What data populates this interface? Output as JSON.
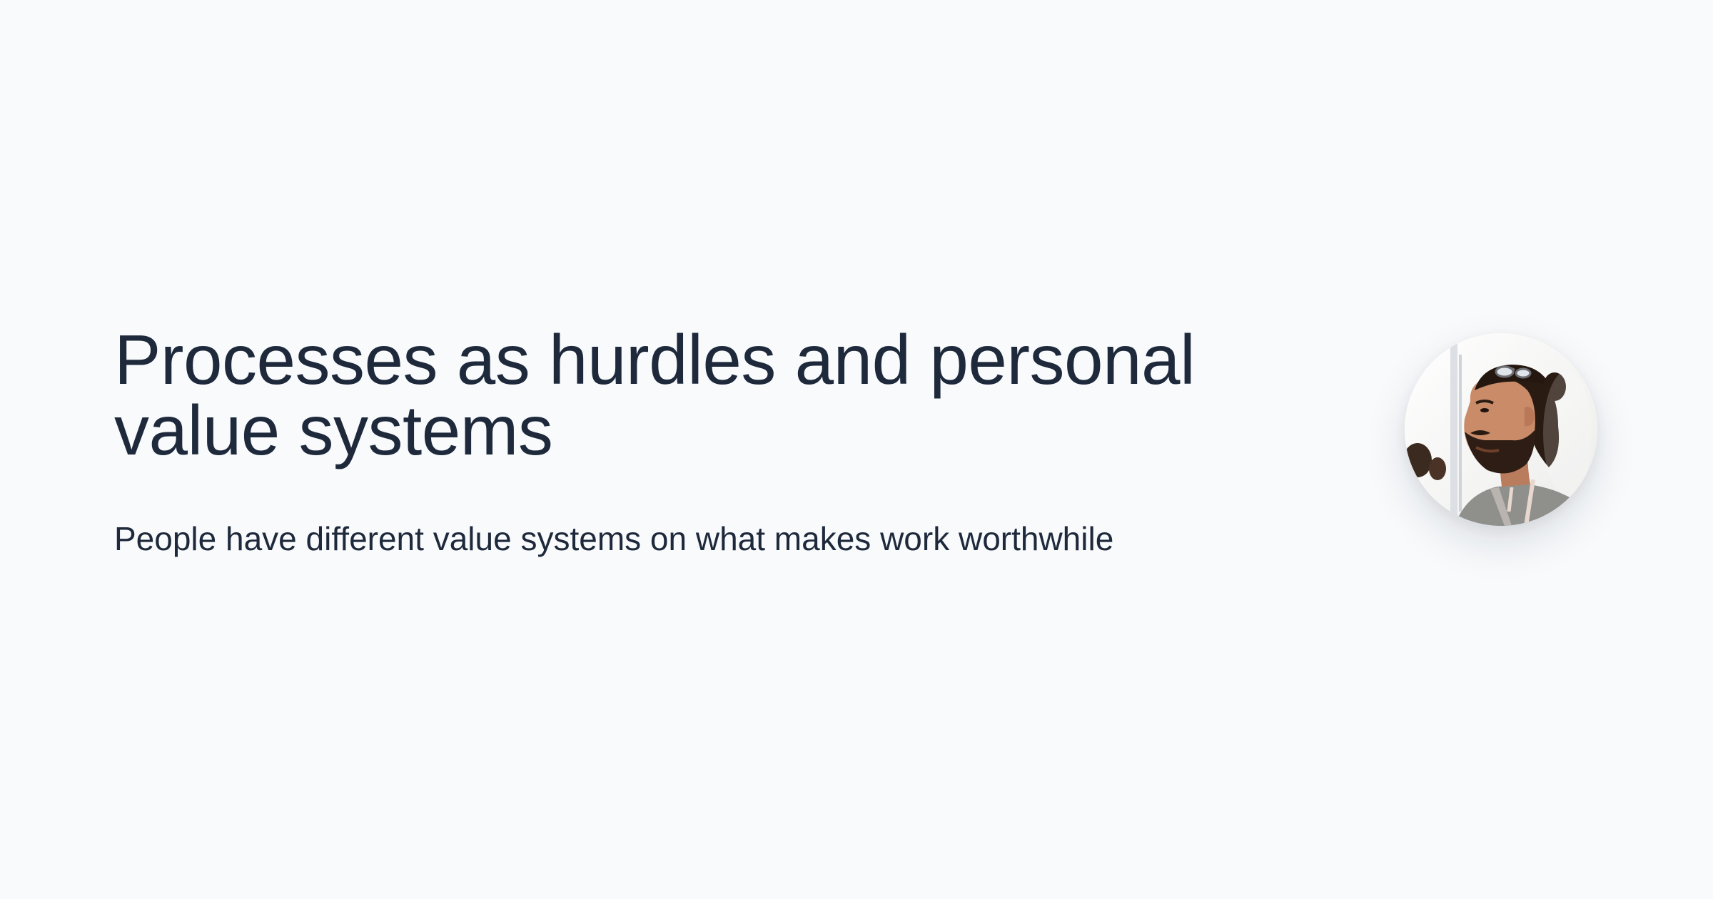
{
  "title": "Processes as hurdles and personal value systems",
  "subtitle": "People have different value systems on what makes work worthwhile",
  "avatar": {
    "icon": "person-photo",
    "colors": {
      "background": "#f5f5f4",
      "hair": "#2a1b12",
      "skin": "#c98b68",
      "shirt": "#8d8d8a",
      "lanyard": "#e7d7cf"
    }
  }
}
